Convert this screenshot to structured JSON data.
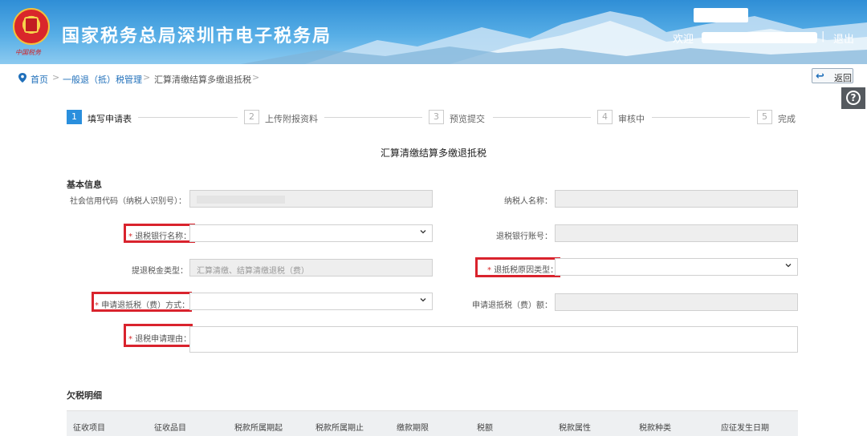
{
  "header": {
    "title": "国家税务总局深圳市电子税务局",
    "welcome": "欢迎",
    "separator": "|",
    "logout": "退出"
  },
  "breadcrumb": {
    "home": "首页",
    "level1": "一般退（抵）税管理",
    "level2": "汇算清缴结算多缴退抵税",
    "separator": ">"
  },
  "back_button": "返回",
  "help_icon_glyph": "?",
  "steps": [
    {
      "num": "1",
      "label": "填写申请表",
      "active": true
    },
    {
      "num": "2",
      "label": "上传附报资料",
      "active": false
    },
    {
      "num": "3",
      "label": "预览提交",
      "active": false
    },
    {
      "num": "4",
      "label": "审核中",
      "active": false
    },
    {
      "num": "5",
      "label": "完成",
      "active": false
    }
  ],
  "form_title": "汇算清缴结算多缴退抵税",
  "basic_info": {
    "title": "基本信息",
    "credit_code_label": "社会信用代码（纳税人识别号）：",
    "taxpayer_name_label": "纳税人名称：",
    "bank_name_label": "退税银行名称：",
    "bank_account_label": "退税银行账号：",
    "refund_type_label": "提退税金类型：",
    "refund_type_value": "汇算清缴、结算清缴退税（费）",
    "refund_reason_label": "退抵税原因类型：",
    "refund_method_label": "申请退抵税（费）方式：",
    "refund_amount_label": "申请退抵税（费）额：",
    "refund_reason_text_label": "退税申请理由：",
    "required_mark": "*"
  },
  "arrears": {
    "title": "欠税明细",
    "columns": [
      "征收项目",
      "征收品目",
      "税款所属期起",
      "税款所属期止",
      "缴款期限",
      "税额",
      "税款属性",
      "税款种类",
      "应征发生日期"
    ]
  },
  "colors": {
    "header_blue": "#2f8ed6",
    "link_blue": "#1f6fba",
    "highlight_red": "#d9232d",
    "step_active": "#2a8fdd"
  },
  "icons": {
    "location": "location-pin-icon",
    "back": "back-arrow-icon",
    "help": "help-icon",
    "dropdown": "chevron-down-icon",
    "emblem": "tax-emblem-icon"
  }
}
